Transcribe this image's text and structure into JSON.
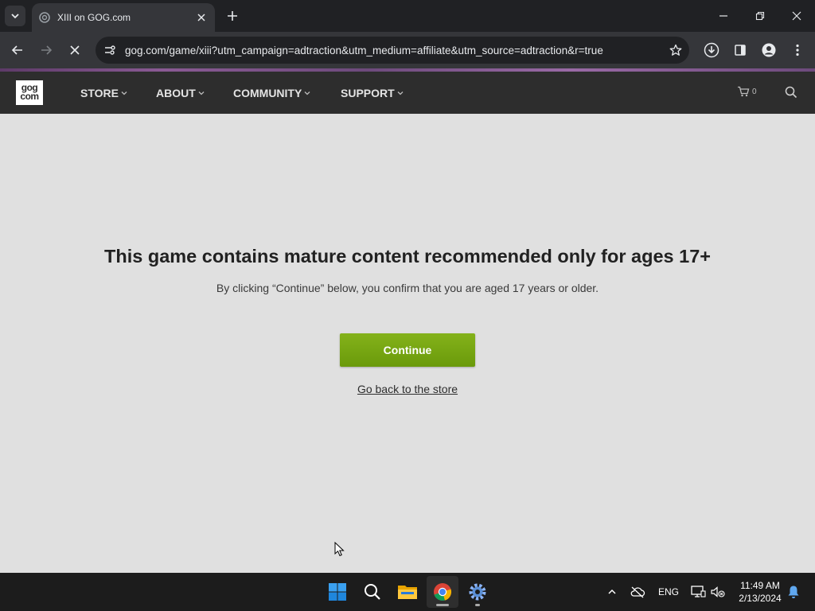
{
  "browser": {
    "tab": {
      "title": "XIII on GOG.com"
    },
    "url": "gog.com/game/xiii?utm_campaign=adtraction&utm_medium=affiliate&utm_source=adtraction&r=true"
  },
  "gog_nav": {
    "logo_line1": "gog",
    "logo_line2": "com",
    "items": [
      {
        "label": "STORE"
      },
      {
        "label": "ABOUT"
      },
      {
        "label": "COMMUNITY"
      },
      {
        "label": "SUPPORT"
      }
    ],
    "cart_count": "0"
  },
  "age_gate": {
    "heading": "This game contains mature content recommended only for ages 17+",
    "subtext": "By clicking “Continue” below, you confirm that you are aged 17 years or older.",
    "continue_label": "Continue",
    "back_label": "Go back to the store"
  },
  "taskbar": {
    "language": "ENG",
    "time": "11:49 AM",
    "date": "2/13/2024"
  },
  "colors": {
    "continue_button": "#7aa813",
    "gog_nav_bg": "#2d2d2d",
    "page_bg": "#e0e0e0"
  }
}
